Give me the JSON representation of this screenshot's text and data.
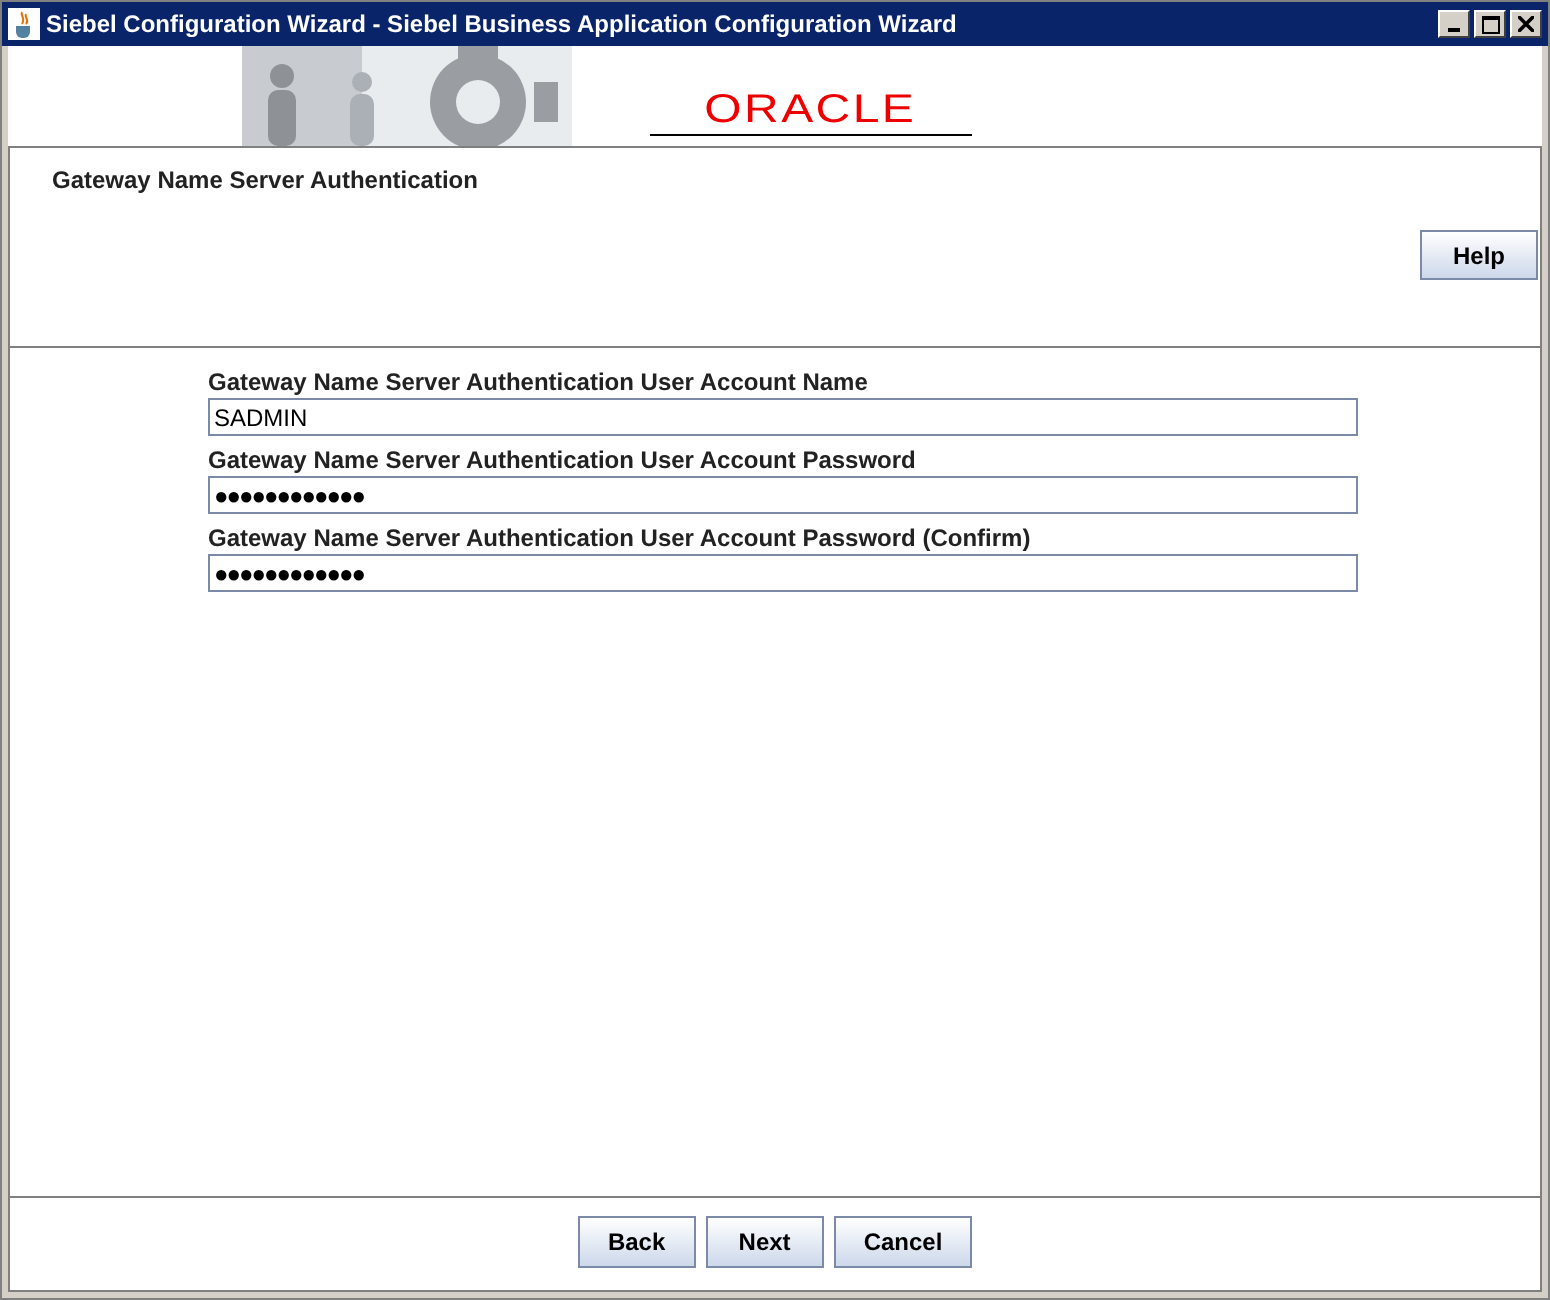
{
  "window": {
    "title": "Siebel Configuration Wizard - Siebel Business Application Configuration Wizard",
    "controls": [
      {
        "kind": "minimize"
      },
      {
        "kind": "maximize"
      },
      {
        "kind": "close"
      }
    ]
  },
  "banner": {
    "logo": "ORACLE"
  },
  "header": {
    "title": "Gateway Name Server Authentication",
    "help_button": "Help"
  },
  "fields": [
    {
      "label": "Gateway Name Server Authentication User Account Name",
      "value": "SADMIN",
      "kind": "text"
    },
    {
      "label": "Gateway Name Server Authentication User Account Password",
      "value": "●●●●●●●●●●●●",
      "kind": "password"
    },
    {
      "label": "Gateway Name Server Authentication User Account Password (Confirm)",
      "value": "●●●●●●●●●●●●",
      "kind": "password"
    }
  ],
  "buttons": [
    "Back",
    "Next",
    "Cancel"
  ]
}
